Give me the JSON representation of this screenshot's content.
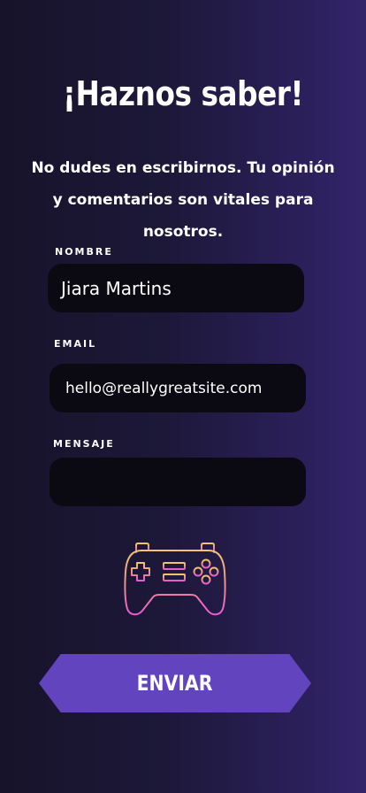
{
  "header": {
    "title": "¡Haznos saber!",
    "subtitle": "No dudes en escribirnos. Tu opinión y comentarios son vitales para nosotros."
  },
  "form": {
    "name_label": "NOMBRE",
    "name_value": "Jiara Martins",
    "email_label": "EMAIL",
    "email_value": "hello@reallygreatsite.com",
    "message_label": "MENSAJE",
    "message_value": "",
    "submit_label": "ENVIAR"
  },
  "decoration": {
    "icon": "gamepad-icon"
  },
  "colors": {
    "background_start": "#17132b",
    "background_end": "#33246a",
    "field_bg": "#0b0a12",
    "button_bg": "#6244bf",
    "icon_gradient_top": "#f4c56a",
    "icon_gradient_bottom": "#e85bd1"
  }
}
